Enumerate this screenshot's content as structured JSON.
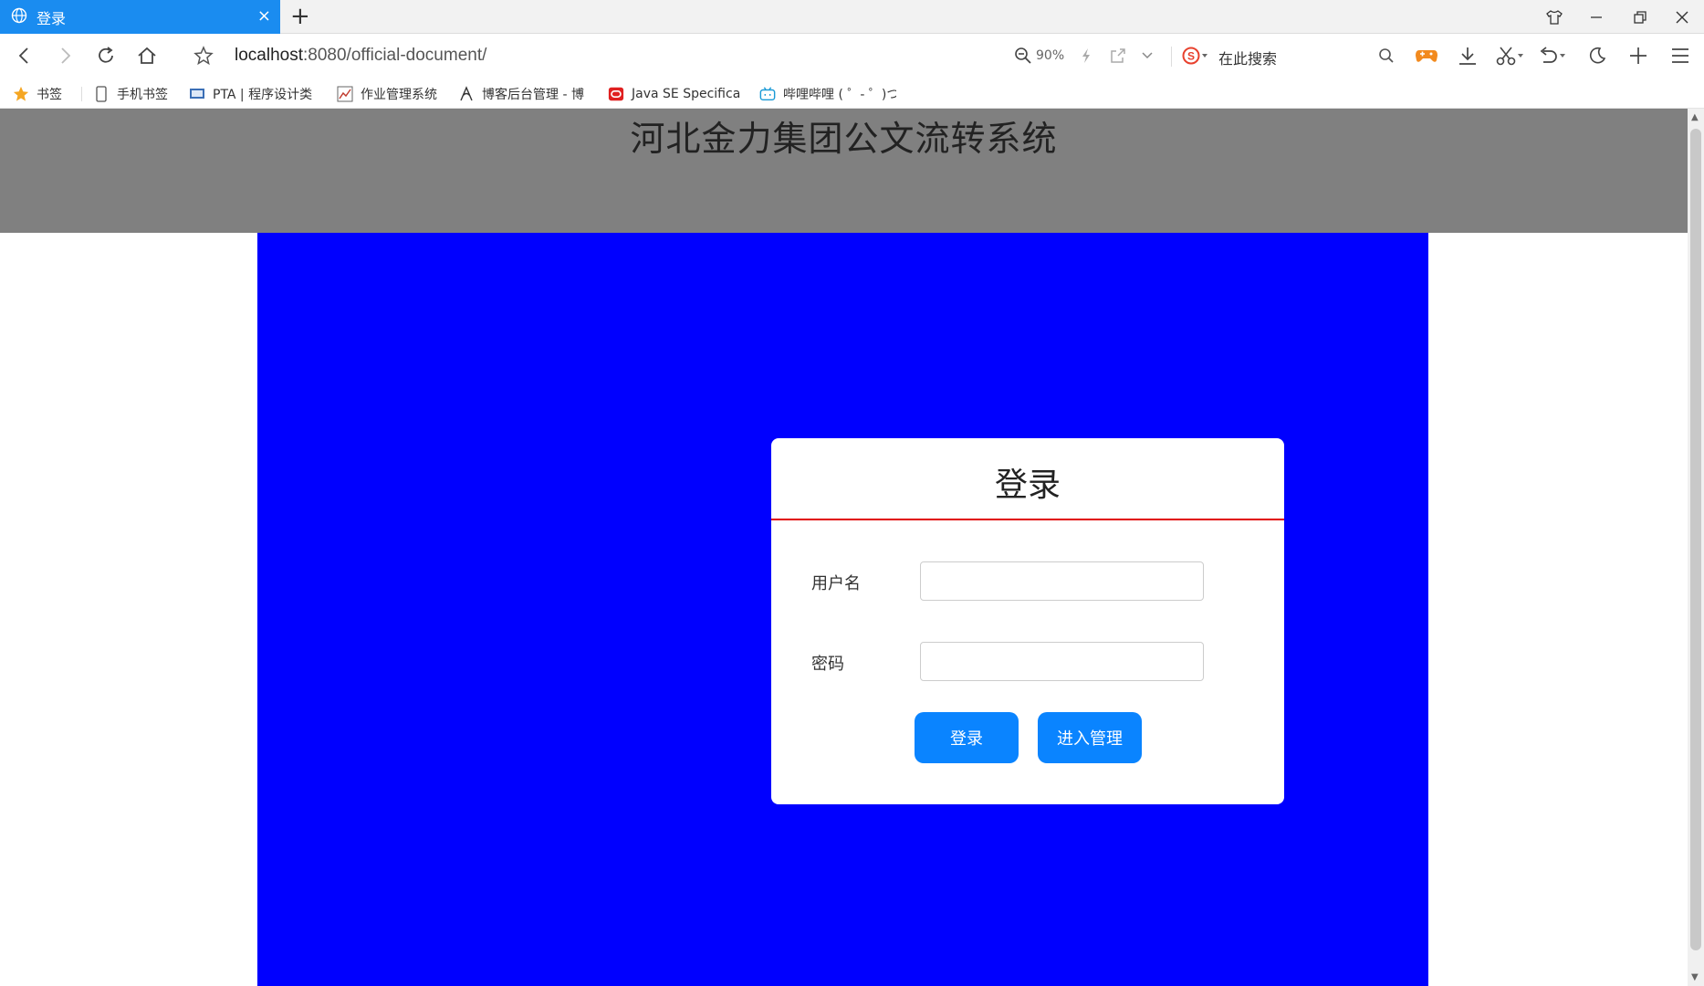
{
  "browser": {
    "tab_title": "登录",
    "tab_close": "×",
    "new_tab": "+",
    "url_host": "localhost",
    "url_rest": ":8080/official-document/",
    "zoom": "90%",
    "search_placeholder": "在此搜索"
  },
  "bookmarks": [
    {
      "label": "书签",
      "icon": "star-icon"
    },
    {
      "label": "手机书签",
      "icon": "phone-icon"
    },
    {
      "label": "PTA | 程序设计类",
      "icon": "pta-icon"
    },
    {
      "label": "作业管理系统",
      "icon": "chart-icon"
    },
    {
      "label": "博客后台管理 - 博",
      "icon": "blog-icon"
    },
    {
      "label": "Java SE Specifica",
      "icon": "oracle-icon"
    },
    {
      "label": "哔哩哔哩 ( ゜- ゜)つ",
      "icon": "bilibili-icon"
    }
  ],
  "page": {
    "title": "河北金力集团公文流转系统",
    "header_bg": "#808080",
    "main_bg": "#0000ff"
  },
  "login": {
    "title": "登录",
    "username_label": "用户名",
    "username_value": "",
    "password_label": "密码",
    "password_value": "",
    "login_button": "登录",
    "admin_button": "进入管理",
    "divider_color": "#e00000",
    "button_color": "#0a84ff"
  }
}
